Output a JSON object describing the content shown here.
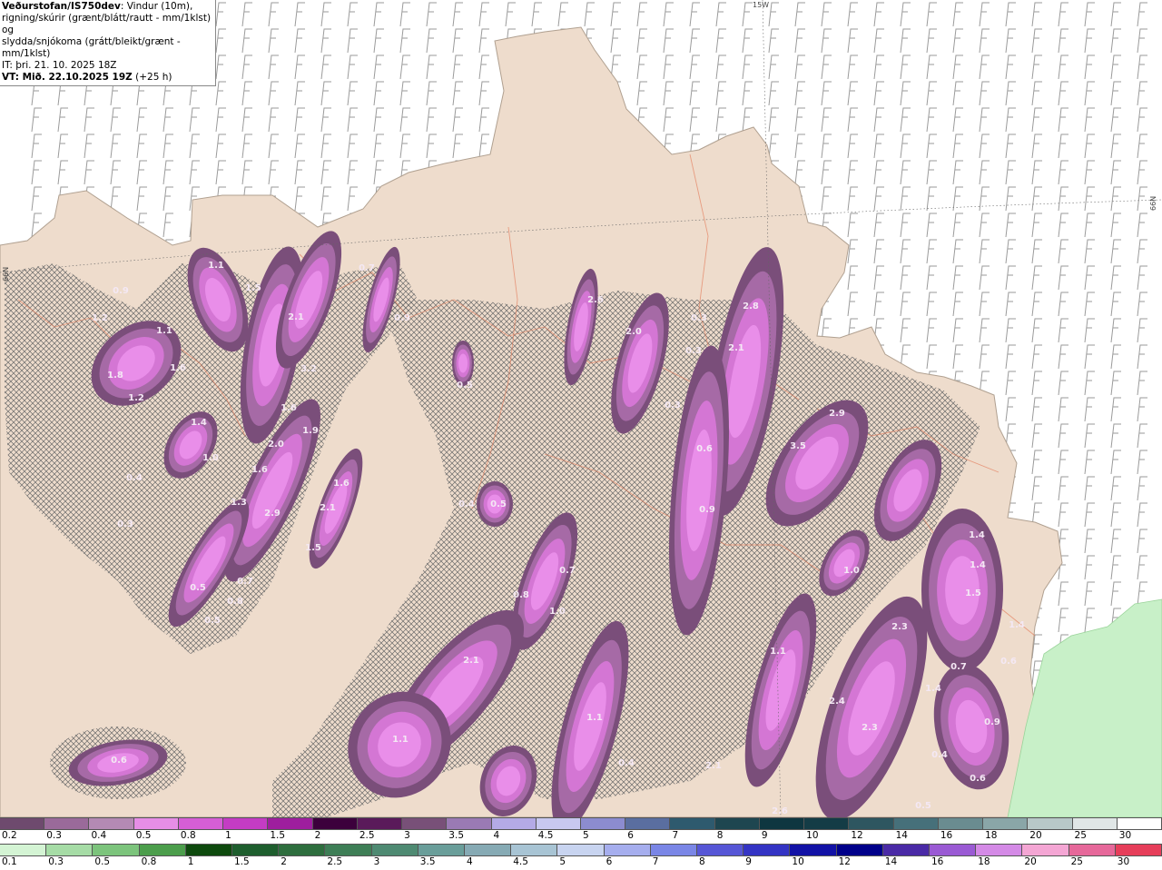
{
  "header": {
    "model": "Veðurstofan/IS750dev",
    "desc1": ": Vindur (10m),",
    "desc2": "rigning/skúrir (grænt/blátt/rautt - mm/1klst) og",
    "desc3": "slydda/snjókoma (grátt/bleikt/grænt - mm/1klst)",
    "it": "IT: þri. 21. 10. 2025 18Z",
    "vt_bold": "VT: Mið. 22.10.2025 19Z",
    "vt_rest": " (+25 h)"
  },
  "grid_labels": {
    "top": "15W",
    "right": "66N",
    "left": "66N"
  },
  "precip_values": [
    "1.1",
    "0.7",
    "1.5",
    "0.9",
    "1.2",
    "2.1",
    "0.9",
    "1.1",
    "1.8",
    "1.6",
    "3.2",
    "1.2",
    "1.4",
    "1.6",
    "2.0",
    "1.9",
    "1.0",
    "0.4",
    "1.6",
    "1.6",
    "1.3",
    "2.9",
    "2.1",
    "0.3",
    "1.5",
    "0.5",
    "0.7",
    "0.8",
    "0.5",
    "2.6",
    "2.0",
    "0.3",
    "2.8",
    "0.3",
    "2.1",
    "0.5",
    "0.3",
    "2.9",
    "3.5",
    "0.6",
    "0.4",
    "0.5",
    "0.9",
    "0.8",
    "0.7",
    "1.0",
    "1.1",
    "1.4",
    "1.4",
    "1.5",
    "1.4",
    "2.3",
    "1.0",
    "2.1",
    "0.7",
    "0.6",
    "1.4",
    "1.1",
    "2.4",
    "0.9",
    "2.3",
    "0.4",
    "0.6",
    "0.4",
    "2.1",
    "1.1",
    "0.6",
    "2.6",
    "0.5"
  ],
  "colorbar_snow": {
    "labels": [
      "0.2",
      "0.3",
      "0.4",
      "0.5",
      "0.8",
      "1",
      "1.5",
      "2",
      "2.5",
      "3",
      "3.5",
      "4",
      "4.5",
      "5",
      "6",
      "7",
      "8",
      "9",
      "10",
      "12",
      "14",
      "16",
      "18",
      "20",
      "25",
      "30"
    ],
    "colors": [
      "#6e4a6e",
      "#9a6a9a",
      "#b48ab4",
      "#e68ee6",
      "#d65ed6",
      "#c43cc4",
      "#9e1e9e",
      "#3c003c",
      "#5a1a5a",
      "#785078",
      "#9a7ab4",
      "#b4aae6",
      "#c8c8f0",
      "#8c8cd0",
      "#5a6ea0",
      "#2e5a6e",
      "#1e4650",
      "#0e3640",
      "#143c46",
      "#2e5660",
      "#46707a",
      "#6a8c90",
      "#8aa6a8",
      "#b8c8c8",
      "#e0e6e6"
    ]
  },
  "colorbar_rain": {
    "labels": [
      "0.1",
      "0.3",
      "0.5",
      "0.8",
      "1",
      "1.5",
      "2",
      "2.5",
      "3",
      "3.5",
      "4",
      "4.5",
      "5",
      "6",
      "7",
      "8",
      "9",
      "10",
      "12",
      "14",
      "16",
      "18",
      "20",
      "25",
      "30"
    ],
    "colors": [
      "#d4f4d4",
      "#a6dca6",
      "#7cc47c",
      "#4c9e4c",
      "#0e4a0e",
      "#1e5e2e",
      "#2e6e3e",
      "#3e7e56",
      "#4e8a72",
      "#6a9e9a",
      "#86aab4",
      "#a8c4d4",
      "#c8d4f0",
      "#a6aeee",
      "#7a86e6",
      "#5656d6",
      "#3434c4",
      "#1212a6",
      "#00008a",
      "#4a2aa6",
      "#9a5ad4",
      "#d48ae6",
      "#f4a6d4",
      "#e6689a",
      "#e63e5a",
      "#e60e0e"
    ]
  }
}
